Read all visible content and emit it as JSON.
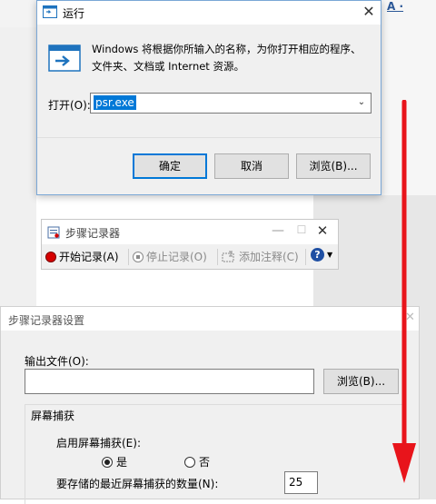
{
  "background": {
    "top_right_text": "A ·",
    "accent": "#2b5797"
  },
  "run_dialog": {
    "title": "运行",
    "close_symbol": "✕",
    "description_line1": "Windows 将根据你所输入的名称，为你打开相应的程序、",
    "description_line2": "文件夹、文档或 Internet 资源。",
    "open_label": "打开(O):",
    "open_value": "psr.exe",
    "ok_label": "确定",
    "cancel_label": "取消",
    "browse_label": "浏览(B)...",
    "selection_color": "#0078d7"
  },
  "psr": {
    "title": "步骤记录器",
    "start_label": "开始记录(A)",
    "stop_label": "停止记录(O)",
    "comment_label": "添加注释(C)",
    "help_symbol": "?",
    "record_color": "#d60000",
    "help_color": "#1f4fa3"
  },
  "settings": {
    "title": "步骤记录器设置",
    "output_label": "输出文件(O):",
    "output_value": "",
    "browse_label": "浏览(B)...",
    "capture_group": "屏幕捕获",
    "enable_label": "启用屏幕捕获(E):",
    "yes_label": "是",
    "no_label": "否",
    "yes_selected": true,
    "count_label": "要存储的最近屏幕捕获的数量(N):",
    "count_value": "25"
  },
  "annotation": {
    "arrow_color": "#e8141b"
  }
}
